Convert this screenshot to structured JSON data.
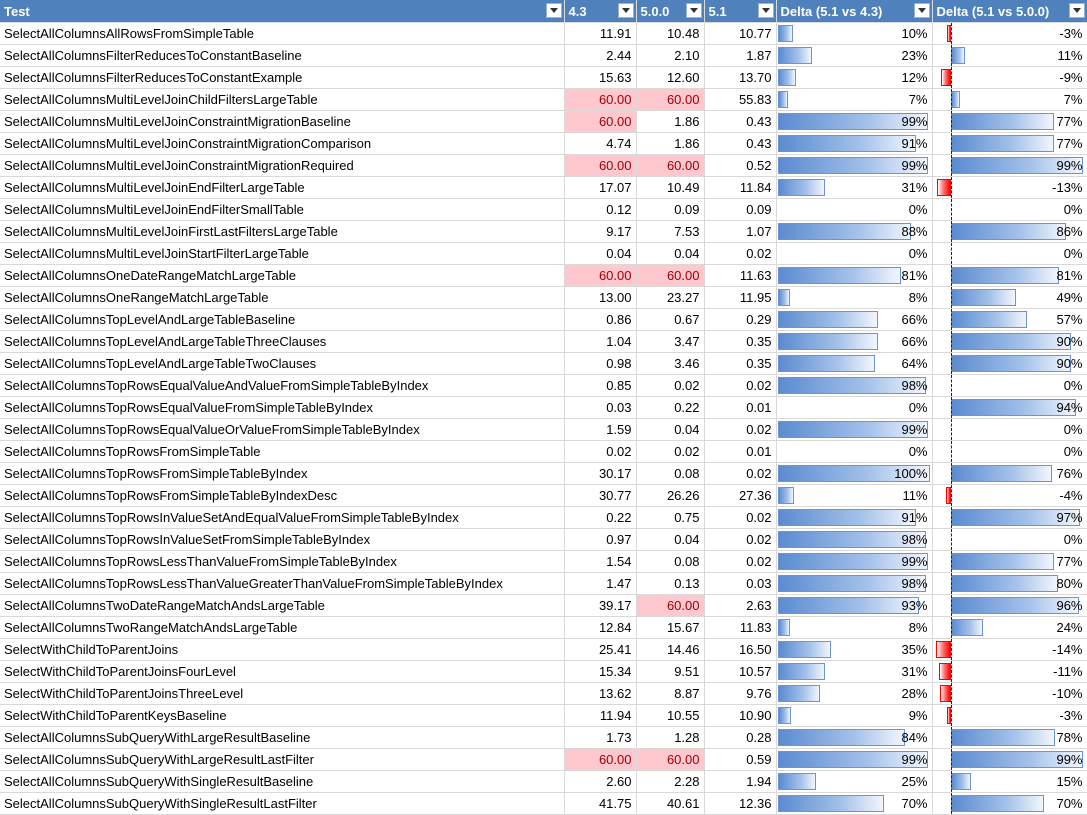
{
  "headers": [
    "Test",
    "4.3",
    "5.0.0",
    "5.1",
    "Delta (5.1 vs 4.3)",
    "Delta (5.1 vs 5.0.0)"
  ],
  "filter_icon": "filter-dropdown-icon",
  "colors": {
    "header_bg": "#4f81bd",
    "highlight_bg": "#ffc7ce",
    "highlight_text": "#9c0006",
    "positive_bar": "#5b8bd0",
    "negative_bar": "#ff0000"
  },
  "rows": [
    {
      "test": "SelectAllColumnsAllRowsFromSimpleTable",
      "v43": "11.91",
      "v50": "10.48",
      "v51": "10.77",
      "d43": 10,
      "d50": -3,
      "d43_label": "10%",
      "d50_label": "-3%",
      "hi43": false,
      "hi50": false
    },
    {
      "test": "SelectAllColumnsFilterReducesToConstantBaseline",
      "v43": "2.44",
      "v50": "2.10",
      "v51": "1.87",
      "d43": 23,
      "d50": 11,
      "d43_label": "23%",
      "d50_label": "11%",
      "hi43": false,
      "hi50": false
    },
    {
      "test": "SelectAllColumnsFilterReducesToConstantExample",
      "v43": "15.63",
      "v50": "12.60",
      "v51": "13.70",
      "d43": 12,
      "d50": -9,
      "d43_label": "12%",
      "d50_label": "-9%",
      "hi43": false,
      "hi50": false
    },
    {
      "test": "SelectAllColumnsMultiLevelJoinChildFiltersLargeTable",
      "v43": "60.00",
      "v50": "60.00",
      "v51": "55.83",
      "d43": 7,
      "d50": 7,
      "d43_label": "7%",
      "d50_label": "7%",
      "hi43": true,
      "hi50": true
    },
    {
      "test": "SelectAllColumnsMultiLevelJoinConstraintMigrationBaseline",
      "v43": "60.00",
      "v50": "1.86",
      "v51": "0.43",
      "d43": 99,
      "d50": 77,
      "d43_label": "99%",
      "d50_label": "77%",
      "hi43": true,
      "hi50": false
    },
    {
      "test": "SelectAllColumnsMultiLevelJoinConstraintMigrationComparison",
      "v43": "4.74",
      "v50": "1.86",
      "v51": "0.43",
      "d43": 91,
      "d50": 77,
      "d43_label": "91%",
      "d50_label": "77%",
      "hi43": false,
      "hi50": false
    },
    {
      "test": "SelectAllColumnsMultiLevelJoinConstraintMigrationRequired",
      "v43": "60.00",
      "v50": "60.00",
      "v51": "0.52",
      "d43": 99,
      "d50": 99,
      "d43_label": "99%",
      "d50_label": "99%",
      "hi43": true,
      "hi50": true
    },
    {
      "test": "SelectAllColumnsMultiLevelJoinEndFilterLargeTable",
      "v43": "17.07",
      "v50": "10.49",
      "v51": "11.84",
      "d43": 31,
      "d50": -13,
      "d43_label": "31%",
      "d50_label": "-13%",
      "hi43": false,
      "hi50": false
    },
    {
      "test": "SelectAllColumnsMultiLevelJoinEndFilterSmallTable",
      "v43": "0.12",
      "v50": "0.09",
      "v51": "0.09",
      "d43": 0,
      "d50": 0,
      "d43_label": "0%",
      "d50_label": "0%",
      "hi43": false,
      "hi50": false
    },
    {
      "test": "SelectAllColumnsMultiLevelJoinFirstLastFiltersLargeTable",
      "v43": "9.17",
      "v50": "7.53",
      "v51": "1.07",
      "d43": 88,
      "d50": 86,
      "d43_label": "88%",
      "d50_label": "86%",
      "hi43": false,
      "hi50": false
    },
    {
      "test": "SelectAllColumnsMultiLevelJoinStartFilterLargeTable",
      "v43": "0.04",
      "v50": "0.04",
      "v51": "0.02",
      "d43": 0,
      "d50": 0,
      "d43_label": "0%",
      "d50_label": "0%",
      "hi43": false,
      "hi50": false
    },
    {
      "test": "SelectAllColumnsOneDateRangeMatchLargeTable",
      "v43": "60.00",
      "v50": "60.00",
      "v51": "11.63",
      "d43": 81,
      "d50": 81,
      "d43_label": "81%",
      "d50_label": "81%",
      "hi43": true,
      "hi50": true
    },
    {
      "test": "SelectAllColumnsOneRangeMatchLargeTable",
      "v43": "13.00",
      "v50": "23.27",
      "v51": "11.95",
      "d43": 8,
      "d50": 49,
      "d43_label": "8%",
      "d50_label": "49%",
      "hi43": false,
      "hi50": false
    },
    {
      "test": "SelectAllColumnsTopLevelAndLargeTableBaseline",
      "v43": "0.86",
      "v50": "0.67",
      "v51": "0.29",
      "d43": 66,
      "d50": 57,
      "d43_label": "66%",
      "d50_label": "57%",
      "hi43": false,
      "hi50": false
    },
    {
      "test": "SelectAllColumnsTopLevelAndLargeTableThreeClauses",
      "v43": "1.04",
      "v50": "3.47",
      "v51": "0.35",
      "d43": 66,
      "d50": 90,
      "d43_label": "66%",
      "d50_label": "90%",
      "hi43": false,
      "hi50": false
    },
    {
      "test": "SelectAllColumnsTopLevelAndLargeTableTwoClauses",
      "v43": "0.98",
      "v50": "3.46",
      "v51": "0.35",
      "d43": 64,
      "d50": 90,
      "d43_label": "64%",
      "d50_label": "90%",
      "hi43": false,
      "hi50": false
    },
    {
      "test": "SelectAllColumnsTopRowsEqualValueAndValueFromSimpleTableByIndex",
      "v43": "0.85",
      "v50": "0.02",
      "v51": "0.02",
      "d43": 98,
      "d50": 0,
      "d43_label": "98%",
      "d50_label": "0%",
      "hi43": false,
      "hi50": false
    },
    {
      "test": "SelectAllColumnsTopRowsEqualValueFromSimpleTableByIndex",
      "v43": "0.03",
      "v50": "0.22",
      "v51": "0.01",
      "d43": 0,
      "d50": 94,
      "d43_label": "0%",
      "d50_label": "94%",
      "hi43": false,
      "hi50": false
    },
    {
      "test": "SelectAllColumnsTopRowsEqualValueOrValueFromSimpleTableByIndex",
      "v43": "1.59",
      "v50": "0.04",
      "v51": "0.02",
      "d43": 99,
      "d50": 0,
      "d43_label": "99%",
      "d50_label": "0%",
      "hi43": false,
      "hi50": false
    },
    {
      "test": "SelectAllColumnsTopRowsFromSimpleTable",
      "v43": "0.02",
      "v50": "0.02",
      "v51": "0.01",
      "d43": 0,
      "d50": 0,
      "d43_label": "0%",
      "d50_label": "0%",
      "hi43": false,
      "hi50": false
    },
    {
      "test": "SelectAllColumnsTopRowsFromSimpleTableByIndex",
      "v43": "30.17",
      "v50": "0.08",
      "v51": "0.02",
      "d43": 100,
      "d50": 76,
      "d43_label": "100%",
      "d50_label": "76%",
      "hi43": false,
      "hi50": false
    },
    {
      "test": "SelectAllColumnsTopRowsFromSimpleTableByIndexDesc",
      "v43": "30.77",
      "v50": "26.26",
      "v51": "27.36",
      "d43": 11,
      "d50": -4,
      "d43_label": "11%",
      "d50_label": "-4%",
      "hi43": false,
      "hi50": false
    },
    {
      "test": "SelectAllColumnsTopRowsInValueSetAndEqualValueFromSimpleTableByIndex",
      "v43": "0.22",
      "v50": "0.75",
      "v51": "0.02",
      "d43": 91,
      "d50": 97,
      "d43_label": "91%",
      "d50_label": "97%",
      "hi43": false,
      "hi50": false
    },
    {
      "test": "SelectAllColumnsTopRowsInValueSetFromSimpleTableByIndex",
      "v43": "0.97",
      "v50": "0.04",
      "v51": "0.02",
      "d43": 98,
      "d50": 0,
      "d43_label": "98%",
      "d50_label": "0%",
      "hi43": false,
      "hi50": false
    },
    {
      "test": "SelectAllColumnsTopRowsLessThanValueFromSimpleTableByIndex",
      "v43": "1.54",
      "v50": "0.08",
      "v51": "0.02",
      "d43": 99,
      "d50": 77,
      "d43_label": "99%",
      "d50_label": "77%",
      "hi43": false,
      "hi50": false
    },
    {
      "test": "SelectAllColumnsTopRowsLessThanValueGreaterThanValueFromSimpleTableByIndex",
      "v43": "1.47",
      "v50": "0.13",
      "v51": "0.03",
      "d43": 98,
      "d50": 80,
      "d43_label": "98%",
      "d50_label": "80%",
      "hi43": false,
      "hi50": false
    },
    {
      "test": "SelectAllColumnsTwoDateRangeMatchAndsLargeTable",
      "v43": "39.17",
      "v50": "60.00",
      "v51": "2.63",
      "d43": 93,
      "d50": 96,
      "d43_label": "93%",
      "d50_label": "96%",
      "hi43": false,
      "hi50": true
    },
    {
      "test": "SelectAllColumnsTwoRangeMatchAndsLargeTable",
      "v43": "12.84",
      "v50": "15.67",
      "v51": "11.83",
      "d43": 8,
      "d50": 24,
      "d43_label": "8%",
      "d50_label": "24%",
      "hi43": false,
      "hi50": false
    },
    {
      "test": "SelectWithChildToParentJoins",
      "v43": "25.41",
      "v50": "14.46",
      "v51": "16.50",
      "d43": 35,
      "d50": -14,
      "d43_label": "35%",
      "d50_label": "-14%",
      "hi43": false,
      "hi50": false
    },
    {
      "test": "SelectWithChildToParentJoinsFourLevel",
      "v43": "15.34",
      "v50": "9.51",
      "v51": "10.57",
      "d43": 31,
      "d50": -11,
      "d43_label": "31%",
      "d50_label": "-11%",
      "hi43": false,
      "hi50": false
    },
    {
      "test": "SelectWithChildToParentJoinsThreeLevel",
      "v43": "13.62",
      "v50": "8.87",
      "v51": "9.76",
      "d43": 28,
      "d50": -10,
      "d43_label": "28%",
      "d50_label": "-10%",
      "hi43": false,
      "hi50": false
    },
    {
      "test": "SelectWithChildToParentKeysBaseline",
      "v43": "11.94",
      "v50": "10.55",
      "v51": "10.90",
      "d43": 9,
      "d50": -3,
      "d43_label": "9%",
      "d50_label": "-3%",
      "hi43": false,
      "hi50": false
    },
    {
      "test": "SelectAllColumnsSubQueryWithLargeResultBaseline",
      "v43": "1.73",
      "v50": "1.28",
      "v51": "0.28",
      "d43": 84,
      "d50": 78,
      "d43_label": "84%",
      "d50_label": "78%",
      "hi43": false,
      "hi50": false
    },
    {
      "test": "SelectAllColumnsSubQueryWithLargeResultLastFilter",
      "v43": "60.00",
      "v50": "60.00",
      "v51": "0.59",
      "d43": 99,
      "d50": 99,
      "d43_label": "99%",
      "d50_label": "99%",
      "hi43": true,
      "hi50": true
    },
    {
      "test": "SelectAllColumnsSubQueryWithSingleResultBaseline",
      "v43": "2.60",
      "v50": "2.28",
      "v51": "1.94",
      "d43": 25,
      "d50": 15,
      "d43_label": "25%",
      "d50_label": "15%",
      "hi43": false,
      "hi50": false
    },
    {
      "test": "SelectAllColumnsSubQueryWithSingleResultLastFilter",
      "v43": "41.75",
      "v50": "40.61",
      "v51": "12.36",
      "d43": 70,
      "d50": 70,
      "d43_label": "70%",
      "d50_label": "70%",
      "hi43": false,
      "hi50": false
    }
  ]
}
